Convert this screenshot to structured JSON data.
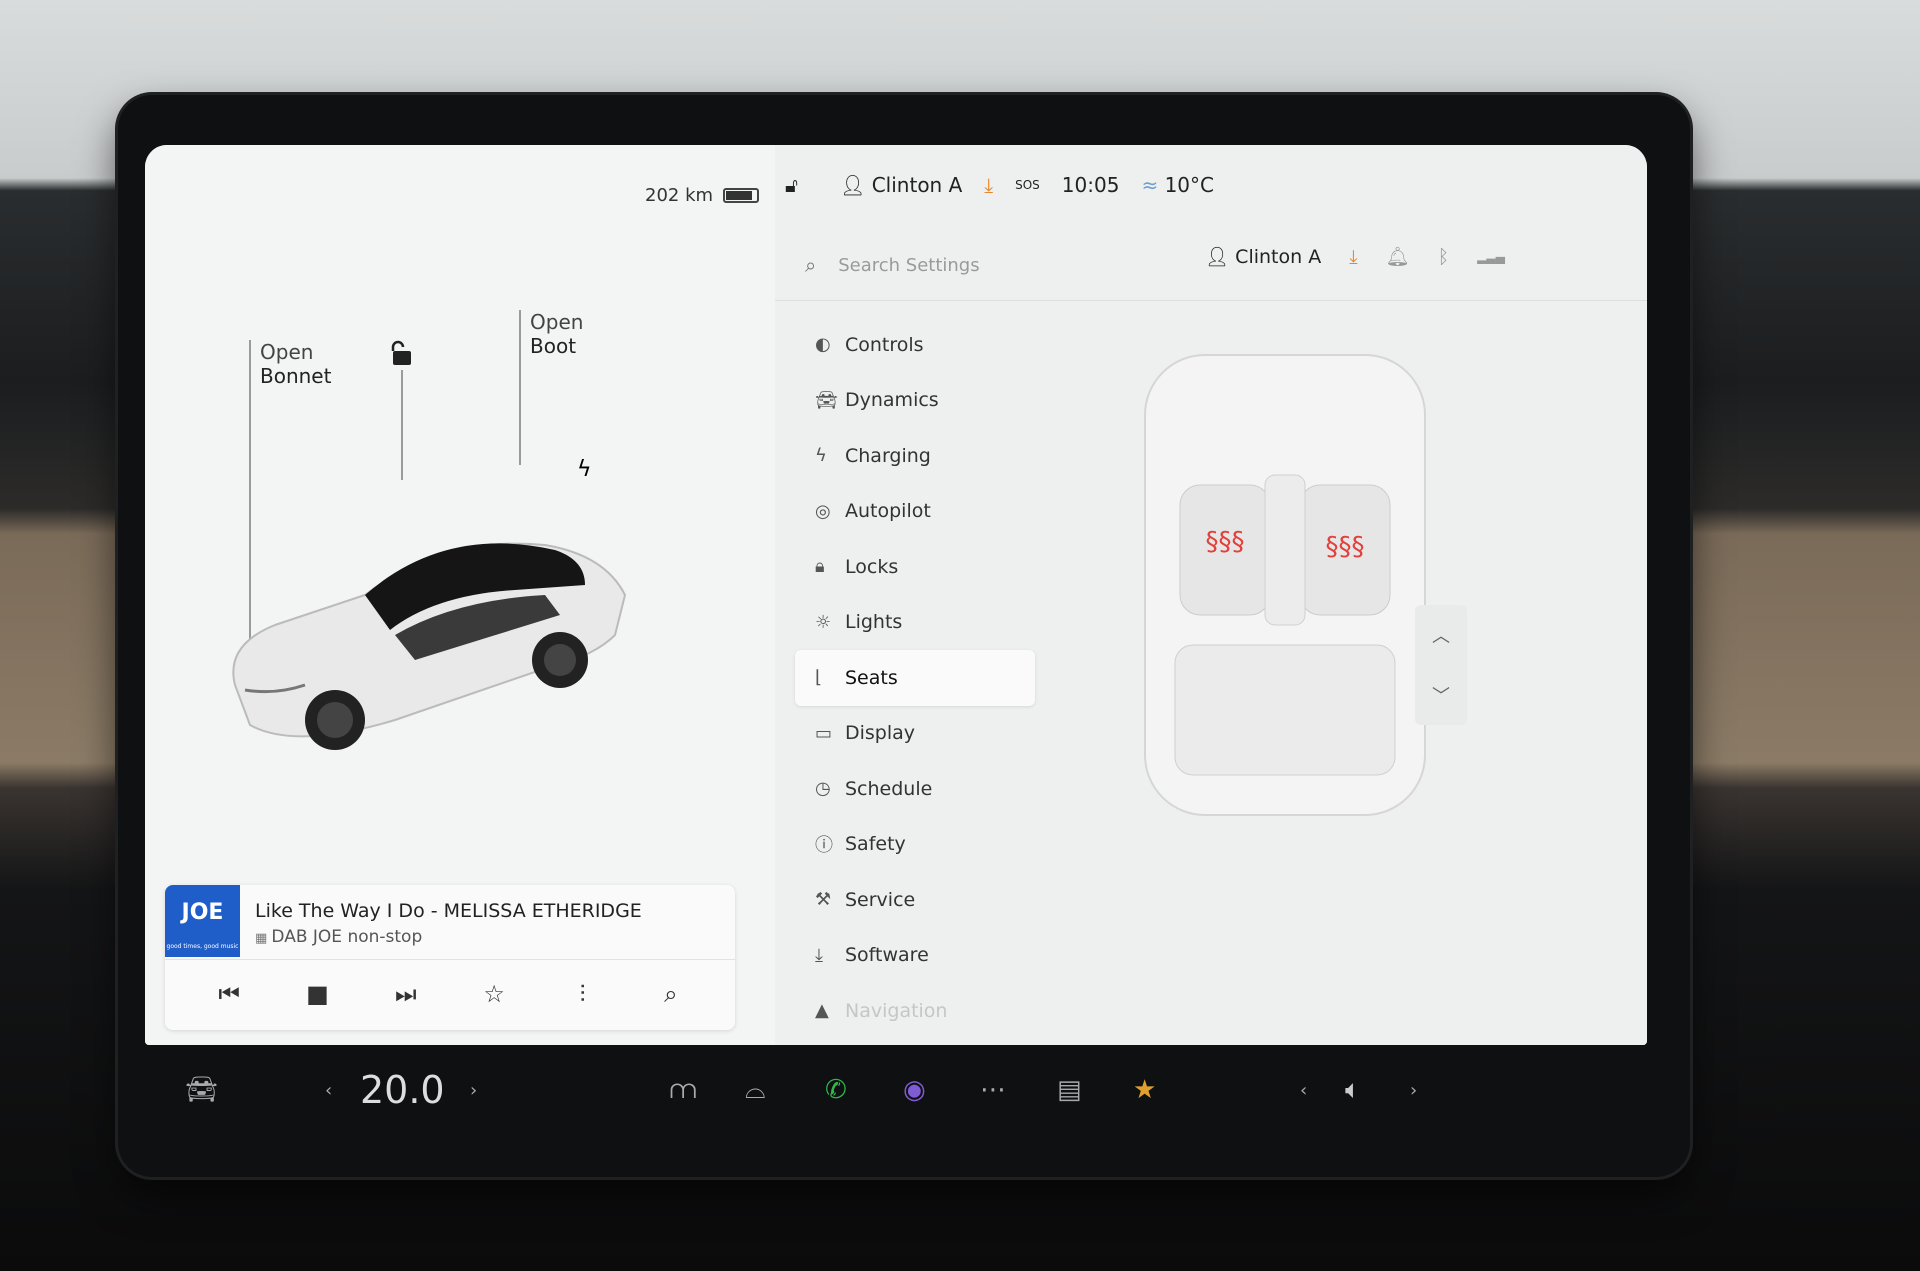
{
  "vehicle": {
    "range": "202 km",
    "bonnet_label_1": "Open",
    "bonnet_label_2": "Bonnet",
    "boot_label_1": "Open",
    "boot_label_2": "Boot"
  },
  "status": {
    "user": "Clinton A",
    "time": "10:05",
    "temperature": "10°C",
    "sos": "SOS"
  },
  "search": {
    "placeholder": "Search Settings"
  },
  "profile": {
    "name": "Clinton A"
  },
  "menu": [
    {
      "label": "Controls",
      "icon": "toggle-icon"
    },
    {
      "label": "Dynamics",
      "icon": "car-icon"
    },
    {
      "label": "Charging",
      "icon": "bolt-icon"
    },
    {
      "label": "Autopilot",
      "icon": "steering-wheel-icon"
    },
    {
      "label": "Locks",
      "icon": "lock-icon"
    },
    {
      "label": "Lights",
      "icon": "sun-icon"
    },
    {
      "label": "Seats",
      "icon": "seat-icon"
    },
    {
      "label": "Display",
      "icon": "display-icon"
    },
    {
      "label": "Schedule",
      "icon": "clock-icon"
    },
    {
      "label": "Safety",
      "icon": "alert-icon"
    },
    {
      "label": "Service",
      "icon": "wrench-icon"
    },
    {
      "label": "Software",
      "icon": "download-icon"
    },
    {
      "label": "Navigation",
      "icon": "navigation-icon"
    }
  ],
  "active_menu": "Seats",
  "media": {
    "logo": "JOE",
    "logo_tagline": "good times, good music",
    "title": "Like The Way I Do - MELISSA ETHERIDGE",
    "source": "DAB JOE non-stop"
  },
  "dock": {
    "cabin_temp": "20.0"
  },
  "colors": {
    "accent": "#e8862b",
    "seat_heat": "#e2403a",
    "phone": "#2fb84d"
  }
}
